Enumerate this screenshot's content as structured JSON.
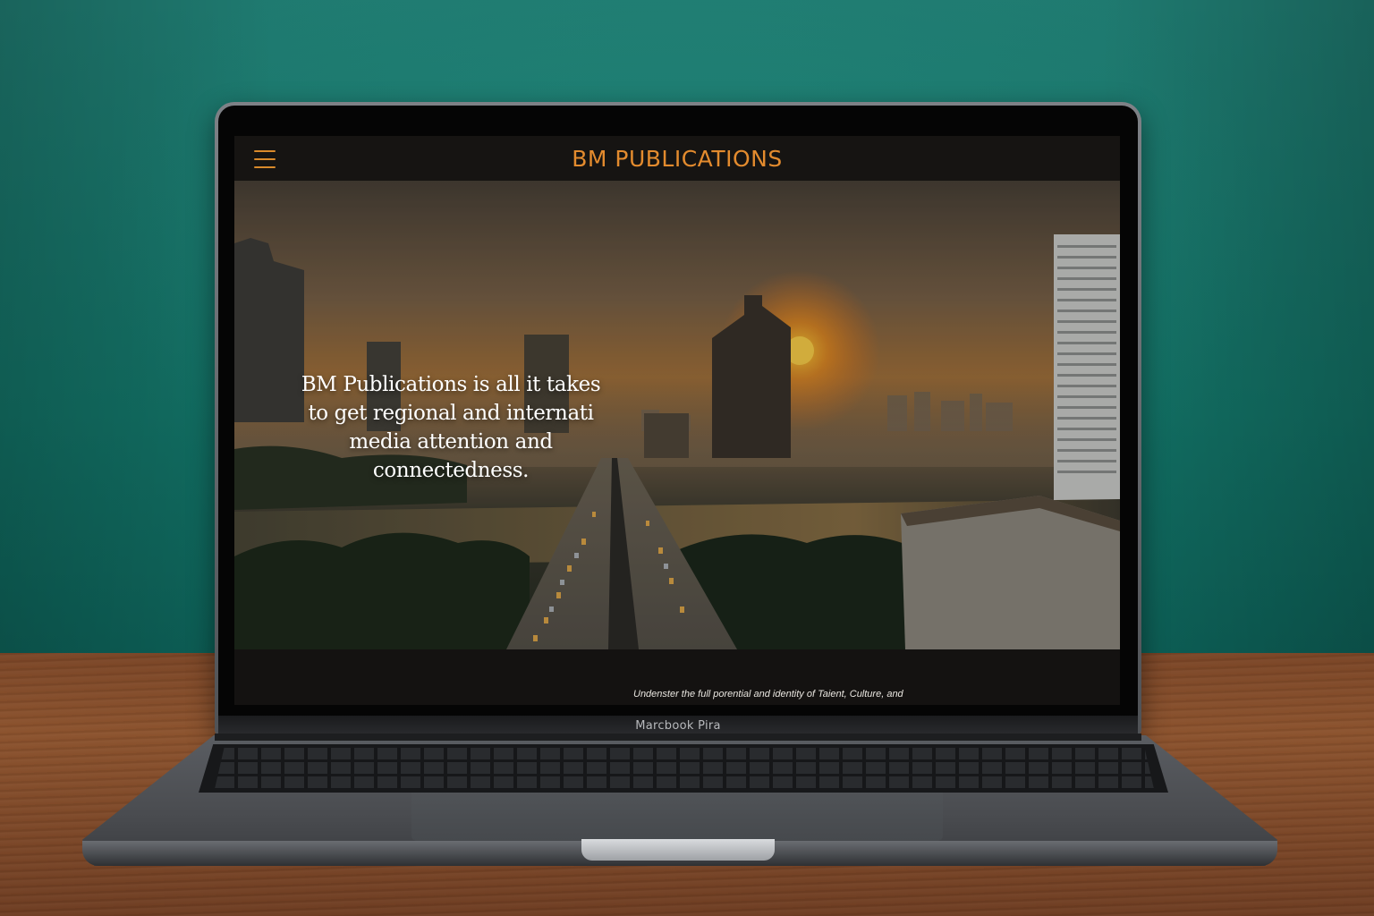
{
  "site": {
    "brand": "BM PUBLICATIONS",
    "menu_icon": "hamburger-menu-icon",
    "brand_color": "#e38b2e",
    "hero": {
      "headline": "BM Publications is all it takes to get regional and internati media attention and connectedness."
    },
    "tagline": "Undenster the full porential and identity of Taient, Culture, and"
  },
  "device": {
    "label": "Marcbook Pira"
  }
}
